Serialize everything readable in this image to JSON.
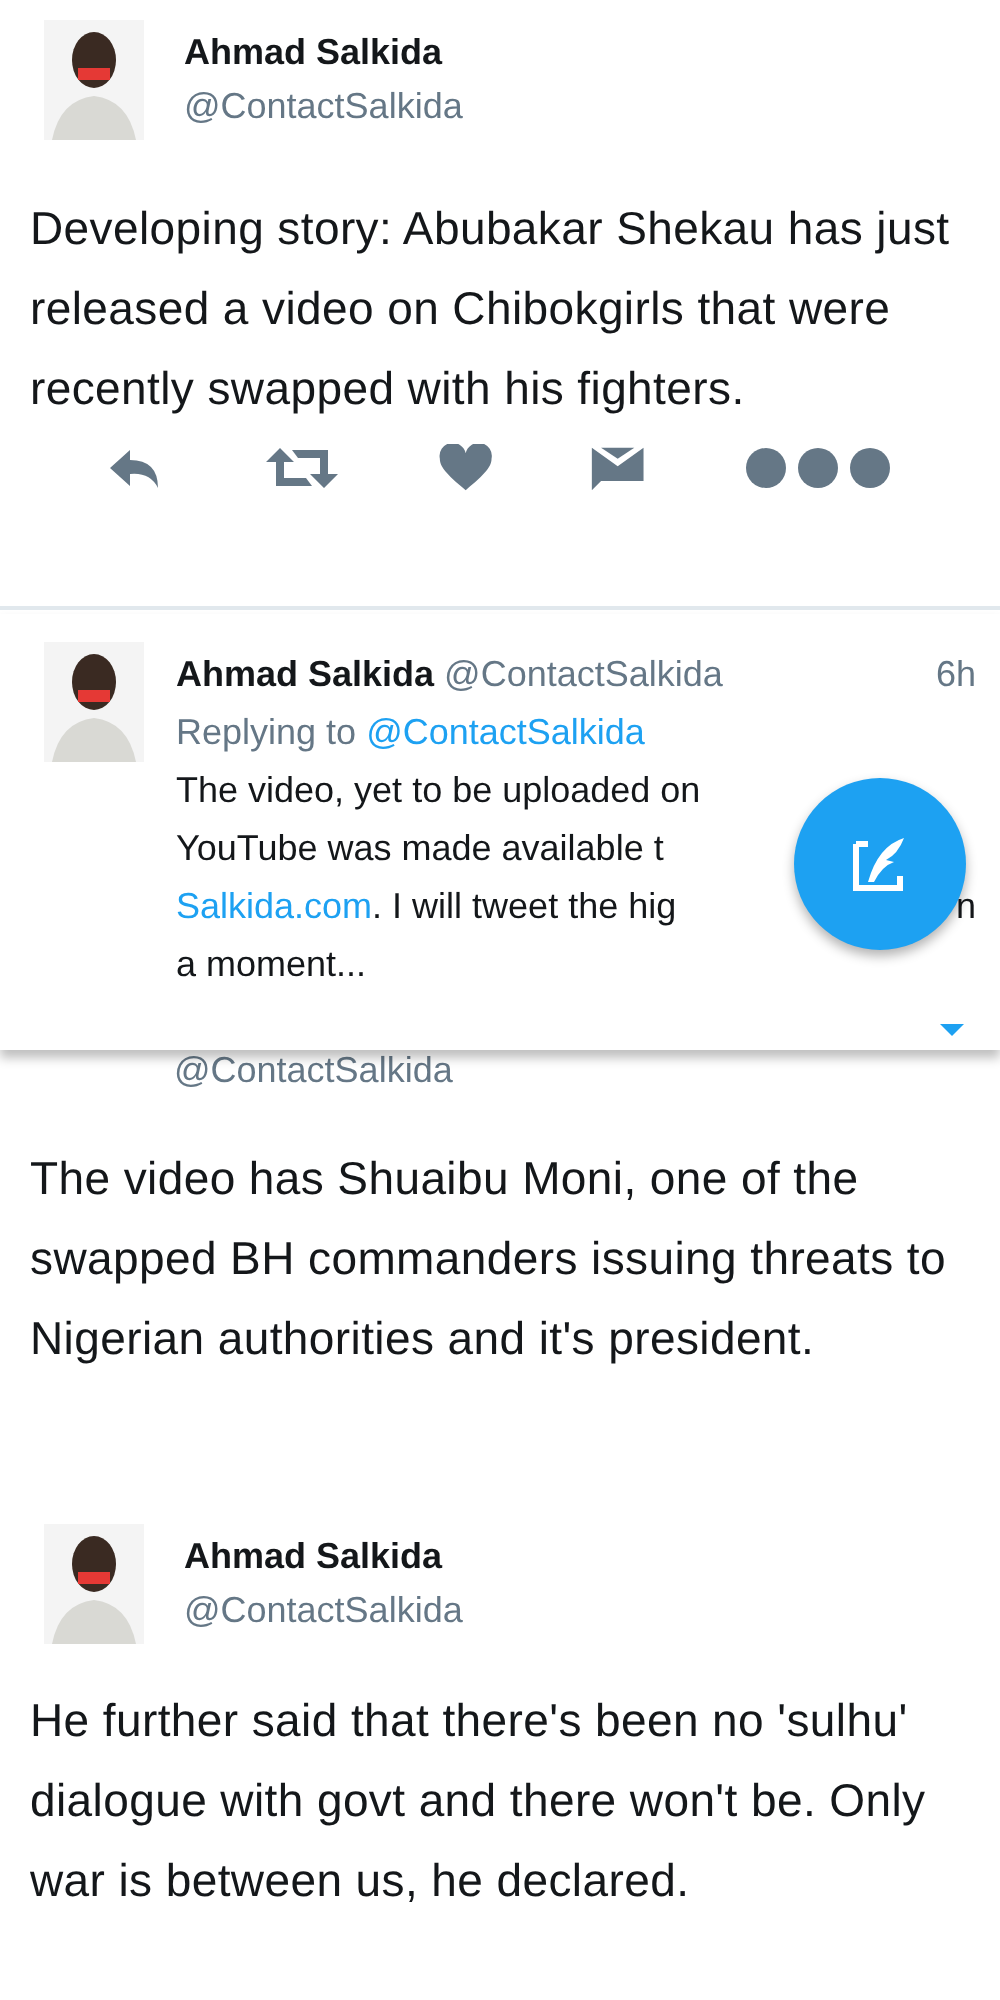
{
  "tweet_1": {
    "name": "Ahmad Salkida",
    "handle": "@ContactSalkida",
    "text": "Developing story: Abubakar Shekau has just released a video on Chibokgirls that were recently swapped with his fighters."
  },
  "reply": {
    "name": "Ahmad Salkida",
    "handle": "@ContactSalkida",
    "time": "6h",
    "replying_label": "Replying to",
    "replying_handle": "@ContactSalkida",
    "lines": [
      {
        "text": "The video, yet to be uploaded on"
      },
      {
        "text": "YouTube was made available t"
      },
      {
        "link": "Salkida.com",
        "text": ". I will tweet the hig",
        "tail": "n"
      },
      {
        "text": "a moment..."
      }
    ]
  },
  "tweet_2": {
    "handle": "@ContactSalkida",
    "text": "The video has Shuaibu Moni, one of the swapped BH commanders issuing threats to Nigerian authorities and it's president."
  },
  "tweet_3": {
    "name": "Ahmad Salkida",
    "handle": "@ContactSalkida",
    "text": "He further said that there's been no 'sulhu' dialogue with govt and there won't be. Only war is between us, he declared."
  }
}
